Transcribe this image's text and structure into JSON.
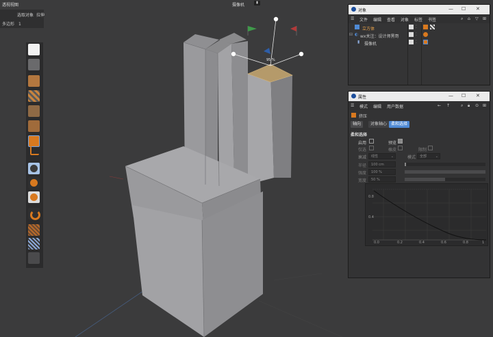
{
  "viewport": {
    "view_name": "透视视图",
    "camera_label": "摄像机",
    "hud": {
      "selected_label": "选取对象",
      "selected_value": "拉伸",
      "polygons_label": "多边形",
      "polygons_value": "1"
    },
    "handle_value": "95 %"
  },
  "objects_panel": {
    "title": "对象",
    "menu": [
      "文件",
      "编辑",
      "查看",
      "对象",
      "标签",
      "书签"
    ],
    "objects": [
      {
        "name": "立方体",
        "selected": true
      },
      {
        "name": "wx关注：设计师黑哥",
        "selected": false
      },
      {
        "name": "摄像机",
        "selected": false
      }
    ]
  },
  "attributes_panel": {
    "title": "属性",
    "menu": [
      "模式",
      "编辑",
      "用户数据"
    ],
    "tool_name": "挤压",
    "tabs": [
      "轴向",
      "对象轴心",
      "柔和选择"
    ],
    "active_tab": "柔和选择",
    "section_title": "柔和选择",
    "rows": [
      {
        "label1": "启用",
        "check1": false,
        "label2": "预览",
        "check2": true
      },
      {
        "label1": "仅选",
        "check1": false,
        "label2": "橡皮",
        "check2": false,
        "label3": "限制",
        "check3": false
      }
    ],
    "falloff_label": "衰减",
    "falloff_value": "线性",
    "mode_label": "模式",
    "mode_value": "全部",
    "radius_label": "半径",
    "radius_value": "100 cm",
    "strength_label": "强度",
    "strength_value": "100 %",
    "width_label": "宽度",
    "width_value": "50 %",
    "graph": {
      "y_ticks": [
        "0.8",
        "0.4"
      ],
      "x_ticks": [
        "0.0",
        "0.2",
        "0.4",
        "0.6",
        "0.8",
        "1"
      ]
    }
  },
  "icons": {
    "toolbar": [
      "model-mode-icon",
      "texture-icon",
      "object-mode-icon",
      "uv-mode-icon",
      "points-mode-icon",
      "edges-mode-icon",
      "polygons-mode-icon",
      "axis-icon",
      "snap-icon",
      "snap-toggle-icon",
      "snap-settings-icon",
      "magnet-icon",
      "workplane-icon",
      "grid-icon",
      "lock-icon"
    ]
  },
  "colors": {
    "selected_face": "#b59a6a",
    "accent": "#4f8ad4",
    "orange_icon": "#d8791f",
    "background": "#3b3b3c"
  }
}
